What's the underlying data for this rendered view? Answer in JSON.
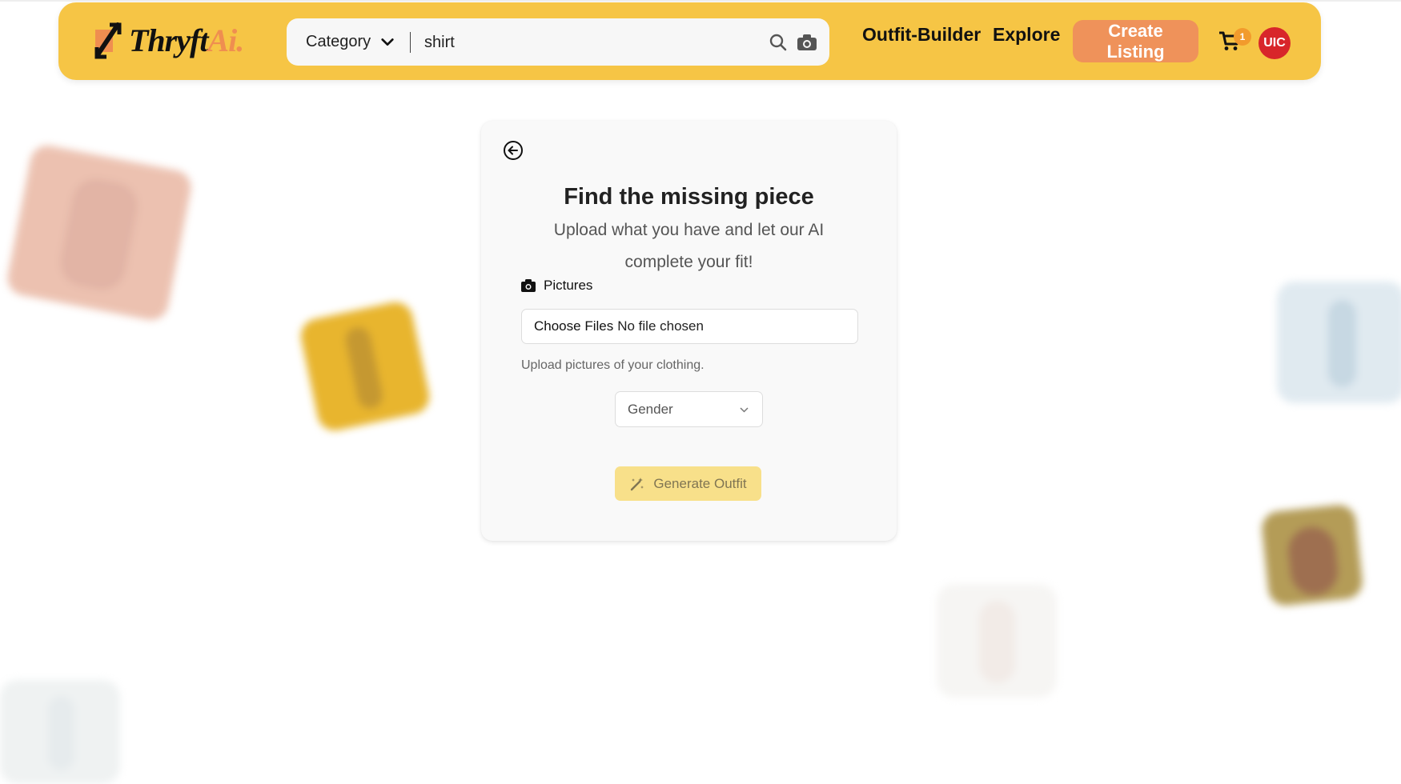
{
  "header": {
    "logo": {
      "text_main": "Thryft",
      "text_accent": "Ai."
    },
    "search": {
      "category_label": "Category",
      "query": "shirt",
      "icons": [
        "search-icon",
        "camera-icon"
      ]
    },
    "nav": {
      "outfit_builder": "Outfit-Builder",
      "explore": "Explore",
      "create_listing": "Create Listing"
    },
    "cart": {
      "icon": "cart-icon",
      "count": "1"
    },
    "avatar": {
      "initials": "UIC"
    }
  },
  "card": {
    "back_icon": "arrow-left-circle-icon",
    "title": "Find the missing piece",
    "subtitle": "Upload what you have and let our AI complete your fit!",
    "pictures_label": "Pictures",
    "file_button": "Choose Files",
    "file_status": "No file chosen",
    "helper_text": "Upload pictures of your clothing.",
    "gender_placeholder": "Gender",
    "generate_button": "Generate Outfit"
  },
  "colors": {
    "header_bg": "#f6c545",
    "accent_orange": "#ef925a",
    "avatar_red": "#d8262a",
    "generate_bg": "#f8e08a"
  }
}
